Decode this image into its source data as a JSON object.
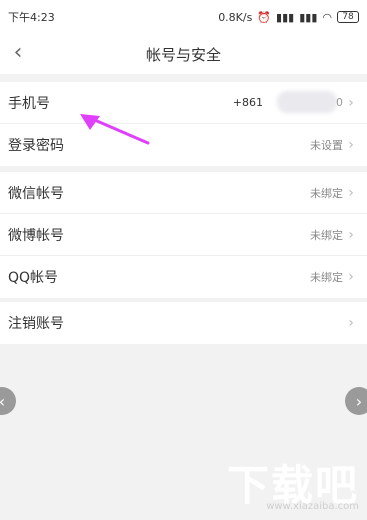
{
  "status_bar": {
    "time": "下午4:23",
    "network_speed": "0.8K/s",
    "alarm_icon": "alarm-icon",
    "signal1_icon": "signal-icon",
    "signal2_icon": "signal-icon",
    "wifi_icon": "wifi-icon",
    "battery": "78"
  },
  "header": {
    "back_icon": "back-icon",
    "title": "帐号与安全"
  },
  "groups": [
    {
      "items": [
        {
          "label": "手机号",
          "value": "+861",
          "value_suffix": "0"
        },
        {
          "label": "登录密码",
          "value": "未设置"
        }
      ]
    },
    {
      "items": [
        {
          "label": "微信帐号",
          "value": "未绑定"
        },
        {
          "label": "微博帐号",
          "value": "未绑定"
        },
        {
          "label": "QQ帐号",
          "value": "未绑定"
        }
      ]
    },
    {
      "items": [
        {
          "label": "注销账号"
        }
      ]
    }
  ],
  "watermark": {
    "main": "下载吧",
    "sub": "www.xiazaiba.com"
  },
  "colors": {
    "arrow": "#e040fb"
  }
}
